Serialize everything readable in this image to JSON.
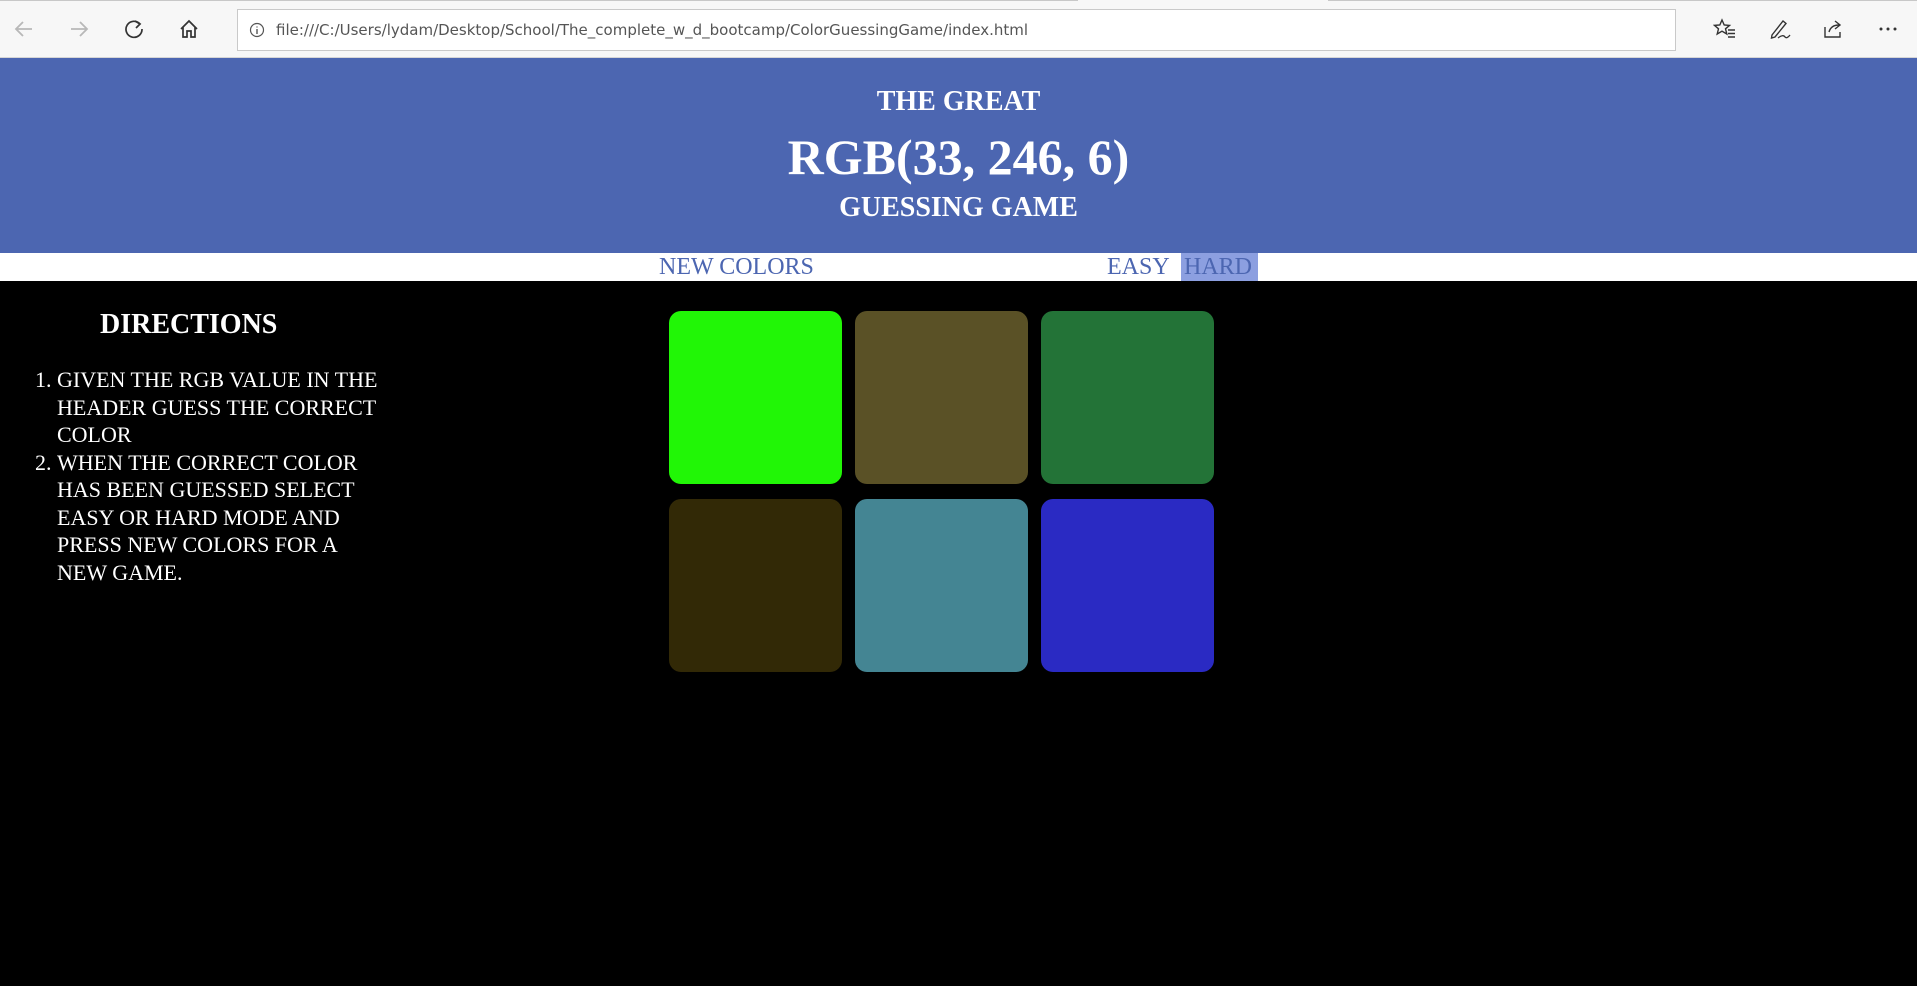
{
  "browser": {
    "url": "file:///C:/Users/lydam/Desktop/School/The_complete_w_d_bootcamp/ColorGuessingGame/index.html",
    "icons": [
      "back-icon",
      "forward-icon",
      "refresh-icon",
      "home-icon",
      "info-icon",
      "favorites-star-icon",
      "pen-icon",
      "share-icon",
      "more-icon"
    ]
  },
  "header": {
    "line1": "THE GREAT",
    "rgb": "RGB(33, 246, 6)",
    "line3": "GUESSING GAME",
    "bg_color": "#4c66b1"
  },
  "stripe": {
    "new_colors": "NEW COLORS",
    "easy": "EASY",
    "hard": "HARD",
    "selected_mode": "HARD"
  },
  "directions": {
    "title": "DIRECTIONS",
    "items": [
      "GIVEN THE RGB VALUE IN THE HEADER GUESS THE CORRECT COLOR",
      "WHEN THE CORRECT COLOR HAS BEEN GUESSED SELECT EASY OR HARD MODE AND PRESS NEW COLORS FOR A NEW GAME."
    ]
  },
  "squares": [
    {
      "color": "#21f606"
    },
    {
      "color": "#5a5126"
    },
    {
      "color": "#237337"
    },
    {
      "color": "#322906"
    },
    {
      "color": "#448593"
    },
    {
      "color": "#2a2ac3"
    }
  ]
}
